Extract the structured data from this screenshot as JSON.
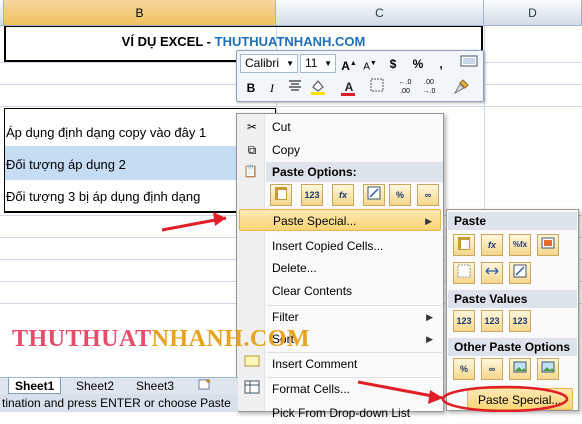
{
  "columns": {
    "b": "B",
    "c": "C",
    "d": "D"
  },
  "sheet": {
    "title_prefix": "VÍ DỤ EXCEL - ",
    "title_brand": "THUTHUATNHANH.COM",
    "row1": "Áp dụng định dạng copy vào đây 1",
    "row2": "Đối tượng áp dụng 2",
    "row3": "Đối tượng 3 bị áp dụng định dạng"
  },
  "mini_toolbar": {
    "font": "Calibri",
    "size": "11",
    "grow": "A",
    "shrink": "A",
    "currency": "$",
    "percent": "%",
    "comma": ",",
    "bold": "B",
    "italic": "I",
    "font_color": "A",
    "inc_decimal": "+.0\n.00",
    "dec_decimal": ".00\n+.0"
  },
  "context_menu": {
    "cut": "Cut",
    "copy": "Copy",
    "paste_options": "Paste Options:",
    "paste_special": "Paste Special...",
    "insert_copied": "Insert Copied Cells...",
    "delete": "Delete...",
    "clear": "Clear Contents",
    "filter": "Filter",
    "sort": "Sort",
    "insert_comment": "Insert Comment",
    "format_cells": "Format Cells...",
    "pick_list": "Pick From Drop-down List"
  },
  "paste_option_icons": [
    "123",
    "fx",
    "%",
    "∞"
  ],
  "submenu": {
    "paste": "Paste",
    "paste_values": "Paste Values",
    "other": "Other Paste Options",
    "paste_special": "Paste Special...",
    "paste_icons": [
      "fx",
      "%fx"
    ],
    "value_icons": [
      "123",
      "123",
      "123"
    ]
  },
  "tabs": [
    "Sheet1",
    "Sheet2",
    "Sheet3"
  ],
  "status": "tination and press ENTER or choose Paste",
  "watermark": {
    "part1": "THUTHUAT",
    "part2": "NHANH.COM"
  },
  "colors": {
    "brand": "#1f6fb8",
    "selection": "#c5dcf3",
    "highlight": "#fbd575",
    "arrow": "#e01e26"
  }
}
